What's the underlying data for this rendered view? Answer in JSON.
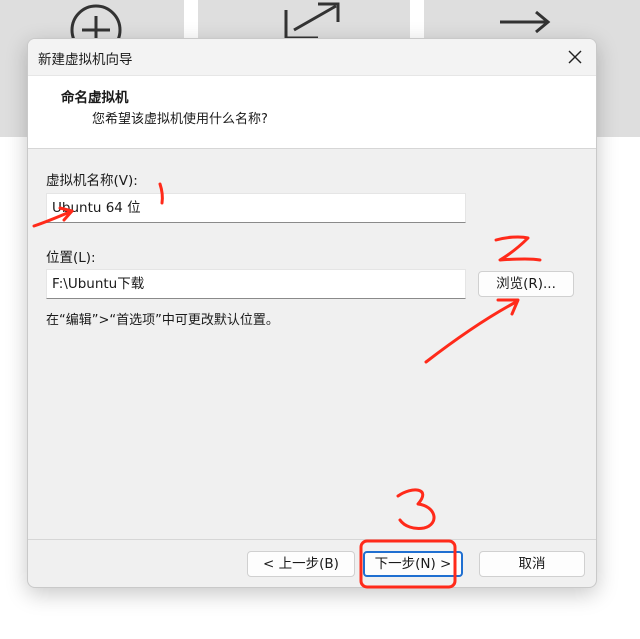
{
  "dialog": {
    "title": "新建虚拟机向导",
    "header_title": "命名虚拟机",
    "header_subtitle": "您希望该虚拟机使用什么名称?",
    "name_label": "虚拟机名称(V):",
    "name_value": "Ubuntu 64 位",
    "location_label": "位置(L):",
    "location_value": "F:\\Ubuntu下载",
    "browse_label": "浏览(R)...",
    "hint": "在“编辑”>“首选项”中可更改默认位置。",
    "back_label": "< 上一步(B)",
    "next_label": "下一步(N) >",
    "cancel_label": "取消"
  },
  "annotations": {
    "color": "#ff2a1a",
    "marks": [
      "1",
      "2",
      "3"
    ]
  },
  "icons": [
    "plus-circle-icon",
    "external-link-icon",
    "arrows-icon",
    "close-icon"
  ]
}
